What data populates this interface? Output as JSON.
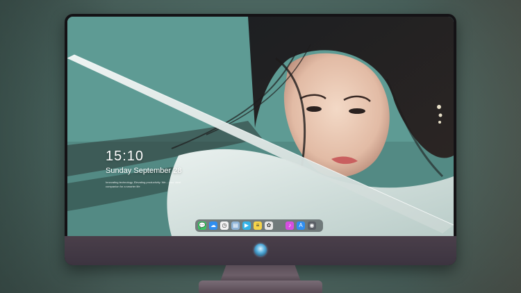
{
  "lock_screen": {
    "time": "15:10",
    "date": "Sunday September 28",
    "tagline": "Innovating technology, Elevating productivity. We... your ideal companion for a smarter life"
  },
  "dock": {
    "apps": [
      {
        "name": "messages-icon",
        "glyph": "💬",
        "color": "#3cc464"
      },
      {
        "name": "finder-icon",
        "glyph": "☁",
        "color": "#2f8ef0"
      },
      {
        "name": "clock-icon",
        "glyph": "◷",
        "color": "#f2f2f2"
      },
      {
        "name": "preview-icon",
        "glyph": "▤",
        "color": "#8fb4d8"
      },
      {
        "name": "video-icon",
        "glyph": "▶",
        "color": "#35b4e8"
      },
      {
        "name": "notes-icon",
        "glyph": "≡",
        "color": "#f5d34a"
      },
      {
        "name": "photos-icon",
        "glyph": "✿",
        "color": "#e8e8e8"
      },
      {
        "name": "music-icon",
        "glyph": "♪",
        "color": "#d64de2"
      },
      {
        "name": "app-store-icon",
        "glyph": "A",
        "color": "#2f8ef0"
      },
      {
        "name": "camera-icon",
        "glyph": "◉",
        "color": "#5b5f66"
      }
    ]
  },
  "colors": {
    "accent": "#5f9a94",
    "monitor_body": "#3c3440"
  }
}
